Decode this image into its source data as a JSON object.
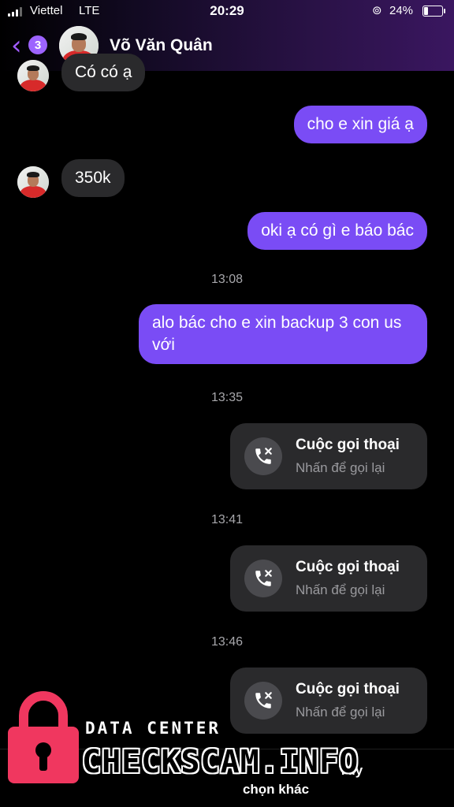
{
  "status_bar": {
    "carrier": "Viettel",
    "network": "LTE",
    "time": "20:29",
    "battery": "24%",
    "battery_fraction": 0.24
  },
  "header": {
    "unread_badge": "3",
    "contact_name": "Võ Văn Quân",
    "accent_color": "#9d63ff"
  },
  "messages": {
    "m0": "Có có ạ",
    "m1": "cho e xin giá ạ",
    "m2": "350k",
    "m3": "oki ạ có gì e báo bác",
    "ts1": "13:08",
    "m4": "alo bác cho e xin backup 3 con us với",
    "ts2": "13:35",
    "ts3": "13:41",
    "ts4": "13:46"
  },
  "calls": {
    "title": "Cuộc gọi thoại",
    "subtitle": "Nhấn để gọi lại",
    "icon": "missed-call-icon"
  },
  "bottom": {
    "options_label_1": "Tùy",
    "options_label_2": "chọn khác"
  },
  "watermark": {
    "line1": "DATA CENTER",
    "line2": "CHECKSCAM.INFO"
  },
  "colors": {
    "outgoing_bubble": "#7a4cf5",
    "incoming_bubble": "#2a2a2c",
    "watermark_lock": "#f0375f"
  }
}
